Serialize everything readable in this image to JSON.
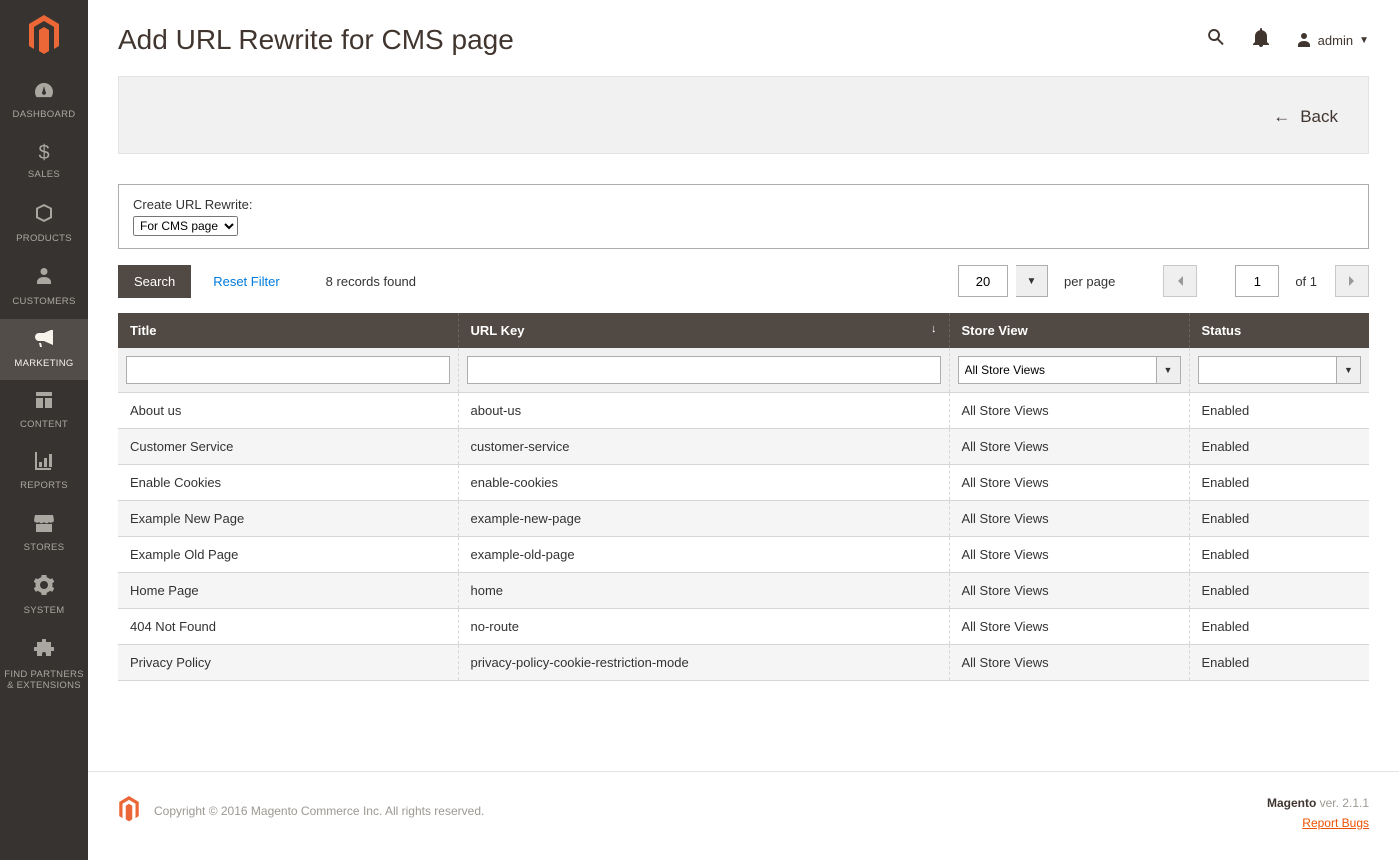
{
  "sidebar": {
    "items": [
      {
        "label": "Dashboard"
      },
      {
        "label": "Sales"
      },
      {
        "label": "Products"
      },
      {
        "label": "Customers"
      },
      {
        "label": "Marketing"
      },
      {
        "label": "Content"
      },
      {
        "label": "Reports"
      },
      {
        "label": "Stores"
      },
      {
        "label": "System"
      },
      {
        "label": "Find Partners & Extensions"
      }
    ]
  },
  "header": {
    "title": "Add URL Rewrite for CMS page",
    "user": "admin"
  },
  "actions": {
    "back": "Back"
  },
  "create_box": {
    "label": "Create URL Rewrite:",
    "selected": "For CMS page"
  },
  "toolbar": {
    "search": "Search",
    "reset": "Reset Filter",
    "records_found": "8 records found",
    "per_page_value": "20",
    "per_page_label": "per page",
    "page_value": "1",
    "page_of": "of 1"
  },
  "grid": {
    "columns": {
      "title": "Title",
      "url_key": "URL Key",
      "store_view": "Store View",
      "status": "Status"
    },
    "filters": {
      "store_view_selected": "All Store Views"
    },
    "rows": [
      {
        "title": "About us",
        "url_key": "about-us",
        "store_view": "All Store Views",
        "status": "Enabled"
      },
      {
        "title": "Customer Service",
        "url_key": "customer-service",
        "store_view": "All Store Views",
        "status": "Enabled"
      },
      {
        "title": "Enable Cookies",
        "url_key": "enable-cookies",
        "store_view": "All Store Views",
        "status": "Enabled"
      },
      {
        "title": "Example New Page",
        "url_key": "example-new-page",
        "store_view": "All Store Views",
        "status": "Enabled"
      },
      {
        "title": "Example Old Page",
        "url_key": "example-old-page",
        "store_view": "All Store Views",
        "status": "Enabled"
      },
      {
        "title": "Home Page",
        "url_key": "home",
        "store_view": "All Store Views",
        "status": "Enabled"
      },
      {
        "title": "404 Not Found",
        "url_key": "no-route",
        "store_view": "All Store Views",
        "status": "Enabled"
      },
      {
        "title": "Privacy Policy",
        "url_key": "privacy-policy-cookie-restriction-mode",
        "store_view": "All Store Views",
        "status": "Enabled"
      }
    ]
  },
  "footer": {
    "copyright": "Copyright © 2016 Magento Commerce Inc. All rights reserved.",
    "version_label": "Magento",
    "version": " ver. 2.1.1",
    "bugs": "Report Bugs"
  }
}
